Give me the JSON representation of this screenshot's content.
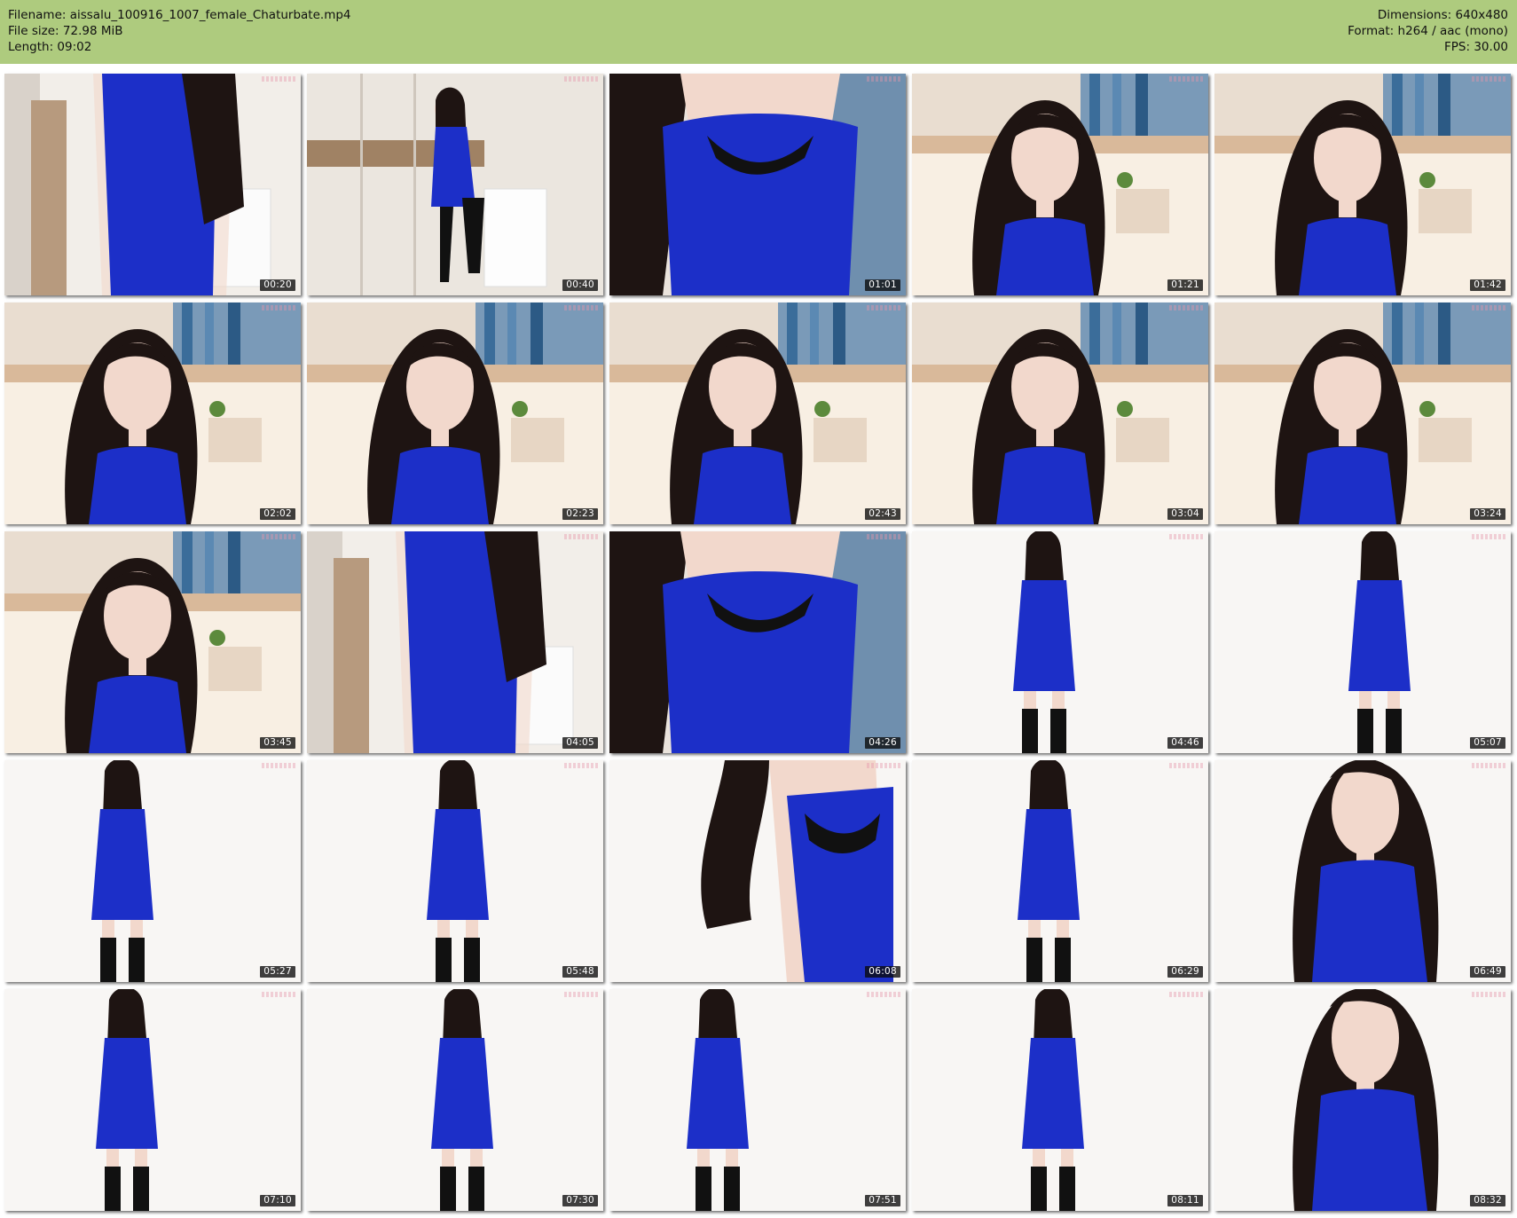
{
  "header": {
    "filename": "Filename: aissalu_100916_1007_female_Chaturbate.mp4",
    "filesize": "File size: 72.98 MiB",
    "length": "Length: 09:02",
    "dimensions": "Dimensions: 640x480",
    "format": "Format: h264 / aac (mono)",
    "fps": "FPS: 30.00"
  },
  "colors": {
    "header_bg": "#aecb7e",
    "dress_blue": "#1c2fc8",
    "hair": "#1e1412"
  },
  "thumbnails": [
    {
      "time": "00:20",
      "scene": "room-closeup"
    },
    {
      "time": "00:40",
      "scene": "room-full"
    },
    {
      "time": "01:01",
      "scene": "torso-closeup"
    },
    {
      "time": "01:21",
      "scene": "bedroom-face"
    },
    {
      "time": "01:42",
      "scene": "bedroom-face"
    },
    {
      "time": "02:02",
      "scene": "bedroom-face"
    },
    {
      "time": "02:23",
      "scene": "bedroom-face"
    },
    {
      "time": "02:43",
      "scene": "bedroom-face"
    },
    {
      "time": "03:04",
      "scene": "bedroom-face"
    },
    {
      "time": "03:24",
      "scene": "bedroom-face"
    },
    {
      "time": "03:45",
      "scene": "bedroom-face"
    },
    {
      "time": "04:05",
      "scene": "room-closeup"
    },
    {
      "time": "04:26",
      "scene": "torso-closeup"
    },
    {
      "time": "04:46",
      "scene": "white-full"
    },
    {
      "time": "05:07",
      "scene": "white-full"
    },
    {
      "time": "05:27",
      "scene": "white-full"
    },
    {
      "time": "05:48",
      "scene": "white-full"
    },
    {
      "time": "06:08",
      "scene": "white-closeup"
    },
    {
      "time": "06:29",
      "scene": "white-full"
    },
    {
      "time": "06:49",
      "scene": "white-face"
    },
    {
      "time": "07:10",
      "scene": "white-full"
    },
    {
      "time": "07:30",
      "scene": "white-full"
    },
    {
      "time": "07:51",
      "scene": "white-full"
    },
    {
      "time": "08:11",
      "scene": "white-full"
    },
    {
      "time": "08:32",
      "scene": "white-face"
    }
  ]
}
